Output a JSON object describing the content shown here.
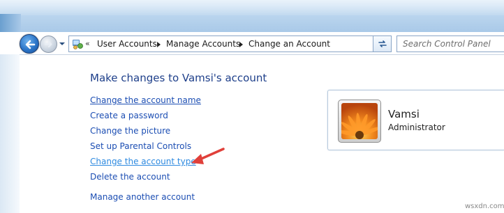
{
  "breadcrumb": {
    "overflow": "«",
    "items": [
      "User Accounts",
      "Manage Accounts",
      "Change an Account"
    ]
  },
  "search": {
    "placeholder": "Search Control Panel"
  },
  "main": {
    "heading": "Make changes to Vamsi's account",
    "links": [
      "Change the account name",
      "Create a password",
      "Change the picture",
      "Set up Parental Controls",
      "Change the account type",
      "Delete the account",
      "Manage another account"
    ]
  },
  "user": {
    "name": "Vamsi",
    "role": "Administrator"
  },
  "watermark": "wsxdn.com",
  "colors": {
    "link": "#1c4eb3",
    "heading": "#1e3f8a",
    "annotation_arrow": "#e0403a"
  },
  "icons": [
    "back-arrow-icon",
    "forward-arrow-icon",
    "control-panel-icon",
    "refresh-icon",
    "flower-avatar"
  ]
}
